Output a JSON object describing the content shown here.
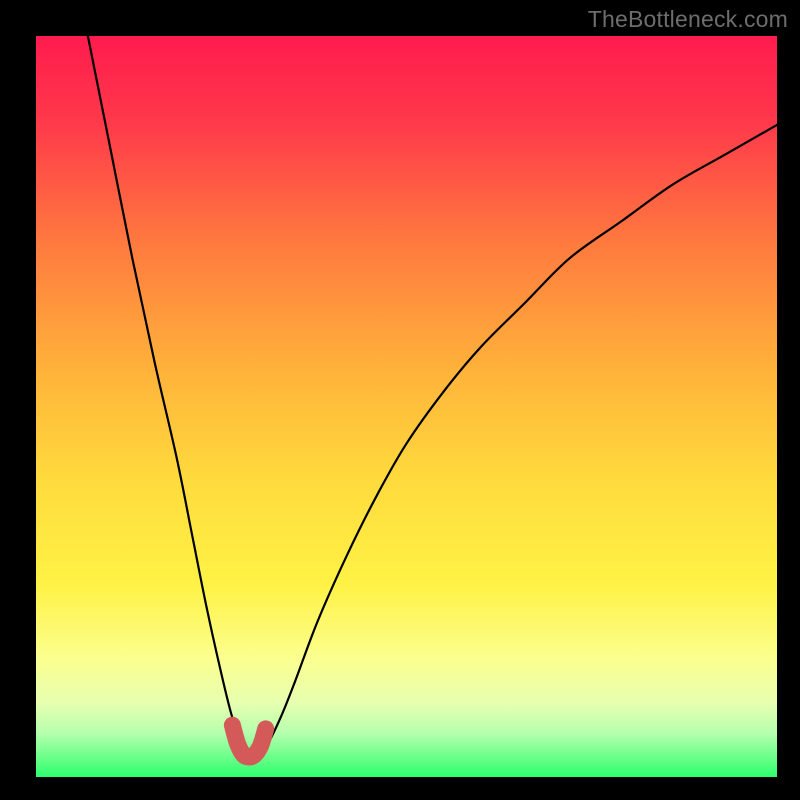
{
  "watermark": "TheBottleneck.com",
  "colors": {
    "frame": "#000000",
    "gradient_top": "#ff1b4e",
    "gradient_mid_orange": "#ff8a3a",
    "gradient_yellow": "#ffe740",
    "gradient_pale": "#f8ffb3",
    "gradient_green_light": "#8dff8d",
    "gradient_green": "#2cff6d",
    "curve_color": "#000000",
    "dip_marker": "#d45a5a"
  },
  "chart_data": {
    "type": "line",
    "title": "",
    "xlabel": "",
    "ylabel": "",
    "xlim": [
      0,
      100
    ],
    "ylim": [
      0,
      100
    ],
    "series": [
      {
        "name": "main-curve",
        "x": [
          7,
          10,
          13,
          16,
          19,
          21,
          23,
          25,
          26.5,
          28,
          29.5,
          31,
          33,
          35,
          38,
          42,
          46,
          50,
          55,
          60,
          66,
          72,
          79,
          86,
          93,
          100
        ],
        "y": [
          100,
          85,
          70,
          56,
          43,
          33,
          23,
          14,
          8,
          4,
          3,
          4,
          8,
          13,
          21,
          30,
          38,
          45,
          52,
          58,
          64,
          70,
          75,
          80,
          84,
          88
        ]
      },
      {
        "name": "dip-marker",
        "x": [
          26.5,
          27.2,
          28,
          28.8,
          29.5,
          30.3,
          31
        ],
        "y": [
          7,
          4.5,
          3,
          2.7,
          3,
          4.2,
          6.5
        ]
      }
    ],
    "min_point": {
      "x": 29,
      "y": 2.7
    },
    "annotations": []
  }
}
